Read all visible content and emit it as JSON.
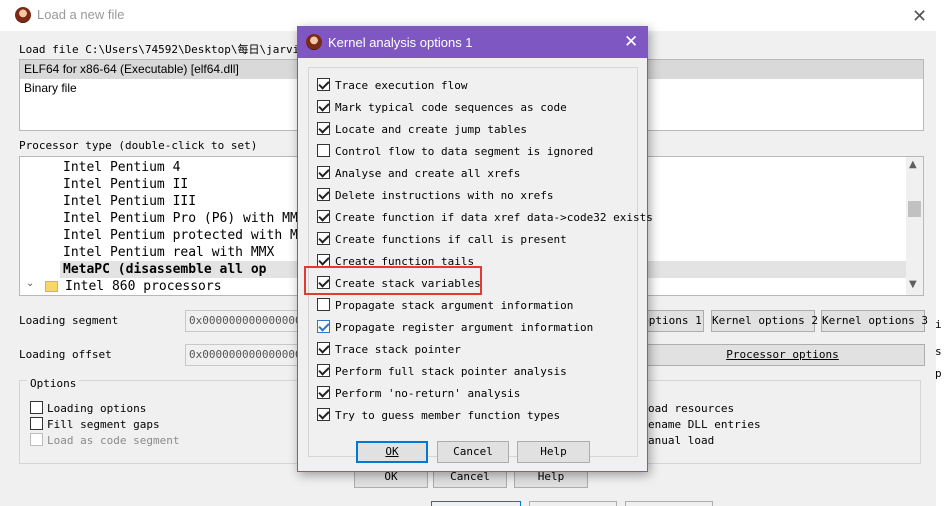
{
  "main": {
    "title": "Load a new file",
    "load_file_label": "Load file C:\\Users\\74592\\Desktop\\每日\\jarvisoj_",
    "file_types": [
      "ELF64 for x86-64 (Executable) [elf64.dll]",
      "Binary file"
    ],
    "processor_type_label": "Processor type (double-click to set)",
    "processors": [
      "Intel Pentium 4",
      "Intel Pentium II",
      "Intel Pentium III",
      "Intel Pentium Pro (P6) with MM",
      "Intel Pentium protected with M",
      "Intel Pentium real with MMX",
      "MetaPC (disassemble all op",
      "Intel 860 processors"
    ],
    "loading_segment_label": "Loading segment",
    "loading_segment_value": "0x0000000000000000",
    "loading_offset_label": "Loading offset",
    "loading_offset_value": "0x0000000000000000",
    "kernel_buttons": [
      "options 1",
      "Kernel options 2",
      "Kernel options 3"
    ],
    "processor_options_label": "Processor options",
    "options_group_label": "Options",
    "options_left": [
      "Loading options",
      "Fill segment gaps",
      "Load as code segment"
    ],
    "options_right": [
      "oad resources",
      "ename DLL entries",
      "anual load"
    ],
    "ok_label": "OK",
    "cancel_label": "Cancel",
    "help_label": "Help",
    "edge_fragments": [
      "i",
      "s",
      "p"
    ]
  },
  "dialog": {
    "title": "Kernel analysis options 1",
    "items": [
      {
        "label": "Trace execution flow",
        "checked": true
      },
      {
        "label": "Mark typical code sequences as code",
        "checked": true
      },
      {
        "label": "Locate and create jump tables",
        "checked": true
      },
      {
        "label": "Control flow to data segment is ignored",
        "checked": false
      },
      {
        "label": "Analyse and create all xrefs",
        "checked": true
      },
      {
        "label": "Delete instructions with no xrefs",
        "checked": true
      },
      {
        "label": "Create function if data xref data->code32 exists",
        "checked": true
      },
      {
        "label": "Create functions if call is present",
        "checked": true
      },
      {
        "label": "Create function tails",
        "checked": true
      },
      {
        "label": "Create stack variables",
        "checked": true
      },
      {
        "label": "Propagate stack argument information",
        "checked": false
      },
      {
        "label": "Propagate register argument information",
        "checked": true
      },
      {
        "label": "Trace stack pointer",
        "checked": true
      },
      {
        "label": "Perform full stack pointer analysis",
        "checked": true
      },
      {
        "label": "Perform 'no-return' analysis",
        "checked": true
      },
      {
        "label": "Try to guess member function types",
        "checked": true
      }
    ],
    "ok_label": "OK",
    "cancel_label": "Cancel",
    "help_label": "Help"
  },
  "colors": {
    "dialog_titlebar": "#7e57c2",
    "highlight_box": "#e53935",
    "focus_blue": "#0078d7"
  }
}
